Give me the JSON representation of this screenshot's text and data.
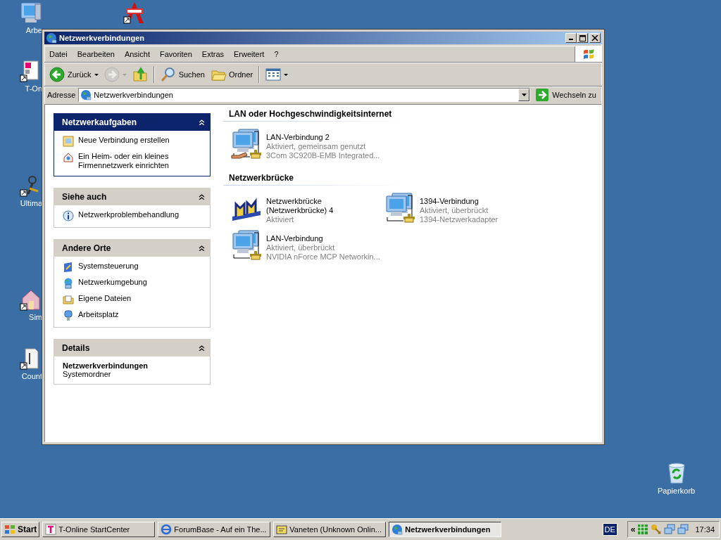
{
  "desktop": {
    "icons": [
      {
        "kind": "computer",
        "label": "Arbe"
      },
      {
        "kind": "acrobat"
      },
      {
        "kind": "tonline",
        "label": "T-On"
      },
      {
        "kind": "tool",
        "label": "Ultima"
      },
      {
        "kind": "sim",
        "label": "Sim"
      },
      {
        "kind": "counter",
        "label": "Count"
      },
      {
        "kind": "recycle",
        "label": "Papierkorb"
      }
    ]
  },
  "window": {
    "title": "Netzwerkverbindungen",
    "menu": [
      "Datei",
      "Bearbeiten",
      "Ansicht",
      "Favoriten",
      "Extras",
      "Erweitert",
      "?"
    ],
    "toolbar": [
      {
        "kind": "back",
        "label": "Zurück",
        "dropdown": true,
        "disabled": false
      },
      {
        "kind": "forward",
        "dropdown": true,
        "disabled": true
      },
      {
        "kind": "up",
        "disabled": false
      },
      {
        "kind": "separator"
      },
      {
        "kind": "search",
        "label": "Suchen",
        "disabled": false
      },
      {
        "kind": "folders",
        "label": "Ordner",
        "disabled": false
      },
      {
        "kind": "separator"
      },
      {
        "kind": "views",
        "dropdown": true,
        "disabled": false
      }
    ],
    "address": {
      "label": "Adresse",
      "value": "Netzwerkverbindungen",
      "go": "Wechseln zu"
    },
    "task_pane": [
      {
        "kind": "special",
        "title": "Netzwerkaufgaben",
        "expanded": true,
        "items": [
          {
            "kind": "wizard",
            "label": "Neue Verbindung erstellen"
          },
          {
            "kind": "home",
            "label": "Ein Heim- oder ein kleines Firmennetzwerk einrichten"
          }
        ]
      },
      {
        "kind": "links",
        "title": "Siehe auch",
        "expanded": true,
        "items": [
          {
            "kind": "info",
            "label": "Netzwerkproblembehandlung"
          }
        ]
      },
      {
        "kind": "links",
        "title": "Andere Orte",
        "expanded": true,
        "items": [
          {
            "kind": "panel",
            "label": "Systemsteuerung"
          },
          {
            "kind": "places",
            "label": "Netzwerkumgebung"
          },
          {
            "kind": "documents",
            "label": "Eigene Dateien"
          },
          {
            "kind": "computer",
            "label": "Arbeitsplatz"
          }
        ]
      },
      {
        "kind": "details",
        "title": "Details",
        "expanded": true,
        "name": "Netzwerkverbindungen",
        "subtitle": "Systemordner"
      }
    ],
    "groups": [
      {
        "title": "LAN oder Hochgeschwindigkeitsinternet",
        "items": [
          {
            "kind": "lan-shared",
            "name": "LAN-Verbindung 2",
            "status": "Aktiviert, gemeinsam genutzt",
            "device": "3Com 3C920B-EMB Integrated..."
          }
        ]
      },
      {
        "title": "Netzwerkbrücke",
        "items": [
          {
            "kind": "bridge",
            "name": "Netzwerkbrücke (Netzwerkbrücke) 4",
            "status": "Aktiviert"
          },
          {
            "kind": "lan",
            "name": "1394-Verbindung",
            "status": "Aktiviert, überbrückt",
            "device": "1394-Netzwerkadapter"
          },
          {
            "kind": "lan",
            "name": "LAN-Verbindung",
            "status": "Aktiviert, überbrückt",
            "device": "NVIDIA nForce MCP Networkin..."
          }
        ]
      }
    ]
  },
  "taskbar": {
    "start": "Start",
    "tasks": [
      {
        "kind": "tonline",
        "label": "T-Online StartCenter",
        "selected": false
      },
      {
        "kind": "browser",
        "label": "ForumBase - Auf ein The...",
        "selected": false
      },
      {
        "kind": "chat",
        "label": "Vaneten (Unknown Onlin...",
        "selected": false
      },
      {
        "kind": "globe",
        "label": "Netzwerkverbindungen",
        "selected": true
      }
    ],
    "language": "DE",
    "chevron": "«",
    "tray_icons": [
      {
        "kind": "grid"
      },
      {
        "kind": "key"
      },
      {
        "kind": "network"
      },
      {
        "kind": "network"
      }
    ],
    "clock": "17:34"
  }
}
